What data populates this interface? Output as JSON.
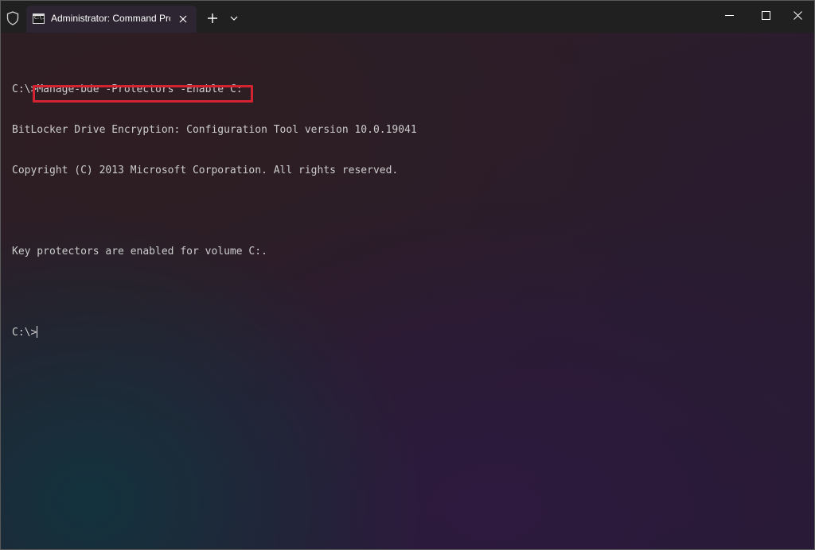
{
  "window": {
    "tab_title": "Administrator: Command Pror",
    "tab_icon_text": "C:\\."
  },
  "titlebar_icons": {
    "shield": "shield-icon",
    "close_tab": "close-icon",
    "new_tab": "plus-icon",
    "dropdown": "chevron-down-icon",
    "minimize": "minimize-icon",
    "maximize": "maximize-icon",
    "close_window": "close-icon"
  },
  "terminal": {
    "prompt": "C:\\>",
    "command": "Manage-bde -Protectors -Enable C:",
    "output": [
      "BitLocker Drive Encryption: Configuration Tool version 10.0.19041",
      "Copyright (C) 2013 Microsoft Corporation. All rights reserved.",
      "",
      "Key protectors are enabled for volume C:.",
      ""
    ],
    "final_prompt": "C:\\>"
  },
  "colors": {
    "highlight_border": "#d42330",
    "text": "#cccccc",
    "titlebar": "#202020"
  }
}
